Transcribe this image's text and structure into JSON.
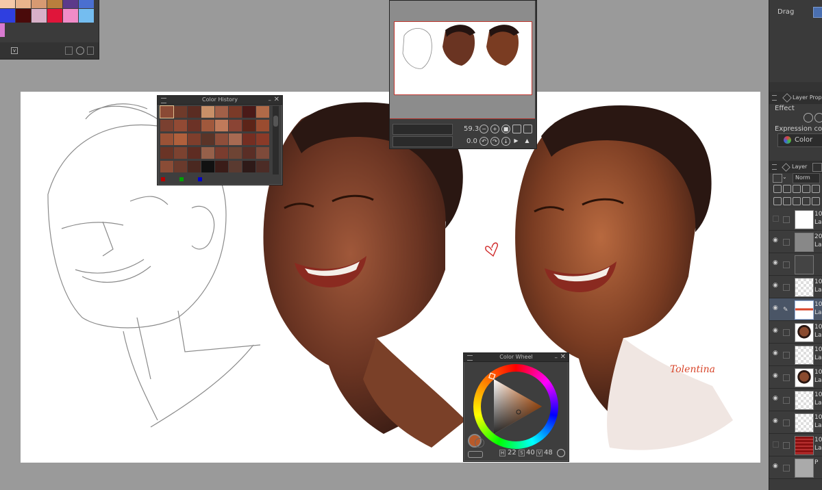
{
  "palette": {
    "swatches": [
      "#f4c9a8",
      "#e8b48c",
      "#d79a72",
      "#b97f3d",
      "#5c3a8a",
      "#4a6fd0",
      "#2f3fe0",
      "#4a0a0a",
      "#d8b0c8",
      "#e0153a",
      "#f08cc8",
      "#74bdf0",
      "#d87ad0"
    ]
  },
  "color_history": {
    "title": "Color History",
    "colors": [
      "#8a4a35",
      "#6e3a2a",
      "#5a2c22",
      "#c89068",
      "#a26048",
      "#7a3a28",
      "#4a1a18",
      "#b06a48",
      "#7a4030",
      "#924a34",
      "#6c3226",
      "#a0583c",
      "#c07a5a",
      "#8a4434",
      "#5c2418",
      "#9a4c30",
      "#9a5236",
      "#b0603c",
      "#7e3e2c",
      "#5a3428",
      "#8e4e3a",
      "#a86a52",
      "#742e22",
      "#8a3a28",
      "#6a3426",
      "#7c4230",
      "#5e2c22",
      "#96604a",
      "#7a3c2e",
      "#6e4434",
      "#5a2e26",
      "#7e4a3a",
      "#8a4c36",
      "#6a3a2c",
      "#4a2820",
      "#111111",
      "#3a1c18",
      "#5a3a30",
      "#2e1a18",
      "#4c2c26"
    ],
    "markers": [
      "#b40000",
      "#00a000",
      "#0000c8"
    ]
  },
  "navigator": {
    "zoom_value": "59.3",
    "rotate_value": "0.0"
  },
  "color_wheel": {
    "title": "Color Wheel",
    "h_value": "22",
    "s_value": "40",
    "v_value": "48",
    "h_label": "H",
    "s_label": "S",
    "v_label": "V",
    "current_color": "#b85a2a"
  },
  "right_panel": {
    "drag_label": "Drag",
    "layer_properties_tab": "Layer Prope",
    "effect_label": "Effect",
    "expression_color_label": "Expression colo",
    "color_select": "Color",
    "layer_tab": "Layer",
    "blend_mode": "Norm",
    "layers": [
      {
        "name_top": "10",
        "name_bottom": "La",
        "visible": false,
        "thumb": "#ffffff",
        "selected": false
      },
      {
        "name_top": "20",
        "name_bottom": "La",
        "visible": true,
        "thumb": "#888888",
        "selected": false
      },
      {
        "name_top": "",
        "name_bottom": "",
        "visible": true,
        "thumb": "#444444",
        "selected": false
      },
      {
        "name_top": "10",
        "name_bottom": "La",
        "visible": true,
        "thumb": "checker",
        "selected": false
      },
      {
        "name_top": "10",
        "name_bottom": "La",
        "visible": true,
        "thumb": "sign",
        "selected": true
      },
      {
        "name_top": "10",
        "name_bottom": "La",
        "visible": true,
        "thumb": "face",
        "selected": false
      },
      {
        "name_top": "10",
        "name_bottom": "La",
        "visible": true,
        "thumb": "checker",
        "selected": false
      },
      {
        "name_top": "10",
        "name_bottom": "La",
        "visible": true,
        "thumb": "face",
        "selected": false
      },
      {
        "name_top": "10",
        "name_bottom": "La",
        "visible": true,
        "thumb": "checker",
        "selected": false
      },
      {
        "name_top": "10",
        "name_bottom": "La",
        "visible": true,
        "thumb": "checker",
        "selected": false
      },
      {
        "name_top": "10",
        "name_bottom": "La",
        "visible": false,
        "thumb": "red",
        "selected": false
      },
      {
        "name_top": "",
        "name_bottom": "P",
        "visible": true,
        "thumb": "#aaaaaa",
        "selected": false
      }
    ]
  },
  "artwork": {
    "signature": "Tolentina"
  }
}
